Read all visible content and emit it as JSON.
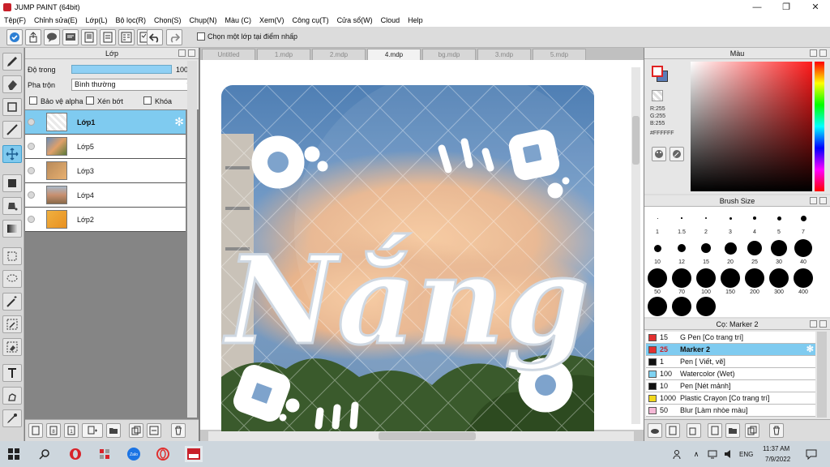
{
  "window": {
    "title": "JUMP PAINT (64bit)"
  },
  "menu": [
    "Tệp(F)",
    "Chỉnh sửa(E)",
    "Lớp(L)",
    "Bộ lọc(R)",
    "Chọn(S)",
    "Chụp(N)",
    "Màu (C)",
    "Xem(V)",
    "Công cụ(T)",
    "Cửa sổ(W)",
    "Cloud",
    "Help"
  ],
  "toolbar": {
    "pick_layer_label": "Chọn một lớp tại điểm nhấp"
  },
  "layer_panel": {
    "title": "Lớp",
    "opacity_label": "Độ trong",
    "opacity_value": "100 %",
    "blend_label": "Pha trộn",
    "blend_value": "Bình thường",
    "protect_alpha": "Bảo vệ alpha",
    "clipping": "Xén bớt",
    "lock": "Khóa",
    "layers": [
      {
        "name": "Lớp1",
        "selected": true
      },
      {
        "name": "Lớp5",
        "selected": false
      },
      {
        "name": "Lớp3",
        "selected": false
      },
      {
        "name": "Lớp4",
        "selected": false
      },
      {
        "name": "Lớp2",
        "selected": false
      }
    ]
  },
  "tabs": [
    "Untitled",
    "1.mdp",
    "2.mdp",
    "4.mdp",
    "bg.mdp",
    "3.mdp",
    "5.mdp"
  ],
  "active_tab": "4.mdp",
  "artwork": {
    "lettering": "Nắng"
  },
  "color_panel": {
    "title": "Màu",
    "r": "R:255",
    "g": "G:255",
    "b": "B:255",
    "hex": "#FFFFFF",
    "main_color": "#ffffff",
    "sub_color": "#5a7db8"
  },
  "brush_panel": {
    "title": "Brush Size",
    "sizes": [
      "1",
      "1.5",
      "2",
      "3",
      "4",
      "5",
      "7",
      "10",
      "12",
      "15",
      "20",
      "25",
      "30",
      "40",
      "50",
      "70",
      "100",
      "150",
      "200",
      "300",
      "400"
    ]
  },
  "tool_panel": {
    "title": "Cọ: Marker 2",
    "presets": [
      {
        "size": "15",
        "name": "G Pen [Co trang trí]",
        "color": "#e23030"
      },
      {
        "size": "25",
        "name": "Marker 2",
        "color": "#e23030",
        "selected": true
      },
      {
        "size": "1",
        "name": "Pen [ Viết, vẽ]",
        "color": "#111111"
      },
      {
        "size": "100",
        "name": "Watercolor (Wet)",
        "color": "#7fd3f2"
      },
      {
        "size": "10",
        "name": "Pen [Nét mảnh]",
        "color": "#111111"
      },
      {
        "size": "1000",
        "name": "Plastic Crayon [Co trang trí]",
        "color": "#f2d81b"
      },
      {
        "size": "50",
        "name": "Blur [Làm nhòe màu]",
        "color": "#f5b8d6"
      }
    ]
  },
  "taskbar": {
    "lang": "ENG",
    "time": "11:37 AM",
    "date": "7/9/2022"
  }
}
